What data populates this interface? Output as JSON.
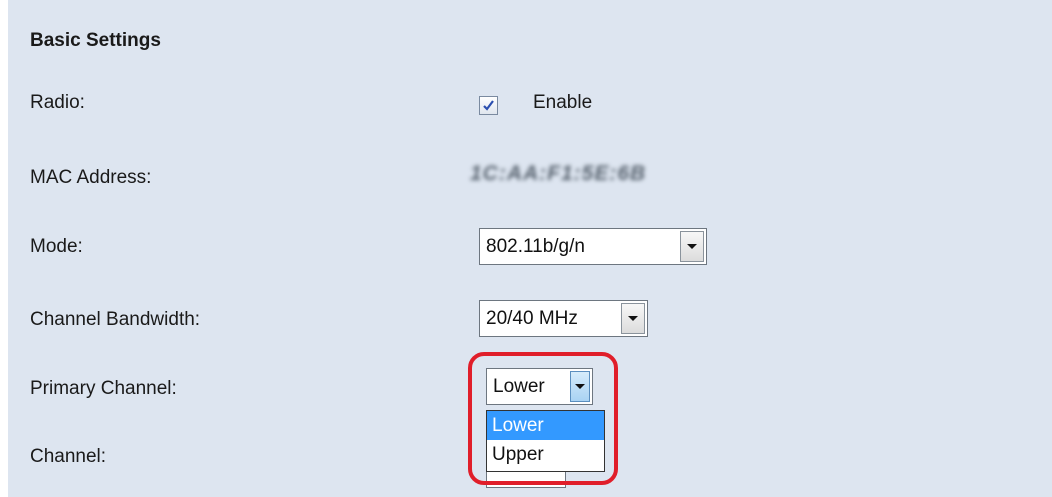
{
  "section": {
    "title": "Basic Settings"
  },
  "radio": {
    "label": "Radio:",
    "checkbox_label": "Enable",
    "checked": true
  },
  "mac": {
    "label": "MAC Address:",
    "value_blurred": "1C:AA:F1:5E:6B"
  },
  "mode": {
    "label": "Mode:",
    "value": "802.11b/g/n"
  },
  "bandwidth": {
    "label": "Channel Bandwidth:",
    "value": "20/40 MHz"
  },
  "primary_channel": {
    "label": "Primary Channel:",
    "value": "Lower",
    "options": [
      "Lower",
      "Upper"
    ],
    "highlighted_option": "Lower"
  },
  "channel": {
    "label": "Channel:"
  },
  "colors": {
    "panel": "#dde5f0",
    "highlight_ring": "#e01e2a",
    "option_selected": "#3399ff"
  },
  "icons": {
    "checkbox": "checkmark-icon",
    "select_arrow": "chevron-down-icon"
  }
}
